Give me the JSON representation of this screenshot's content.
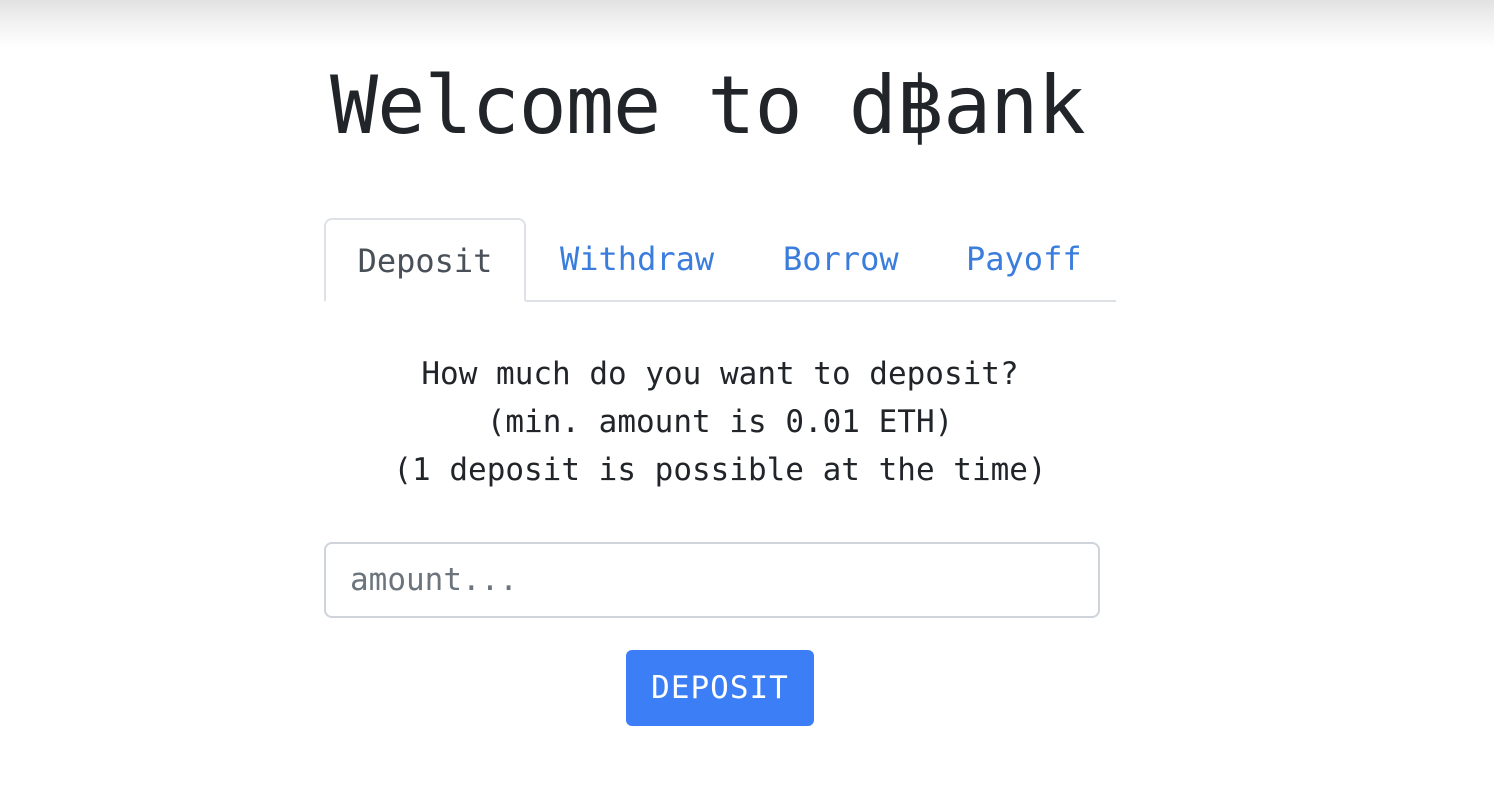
{
  "header": {
    "title": "Welcome to d฿ank"
  },
  "tabs": [
    {
      "label": "Deposit",
      "active": true
    },
    {
      "label": "Withdraw",
      "active": false
    },
    {
      "label": "Borrow",
      "active": false
    },
    {
      "label": "Payoff",
      "active": false
    }
  ],
  "deposit": {
    "prompt_lines": [
      "How much do you want to deposit?",
      "(min. amount is 0.01 ETH)",
      "(1 deposit is possible at the time)"
    ],
    "amount_placeholder": "amount...",
    "amount_value": "",
    "button_label": "DEPOSIT"
  },
  "colors": {
    "accent": "#3b7ef5",
    "tab_link": "#3b7ddd",
    "text": "#212529"
  }
}
